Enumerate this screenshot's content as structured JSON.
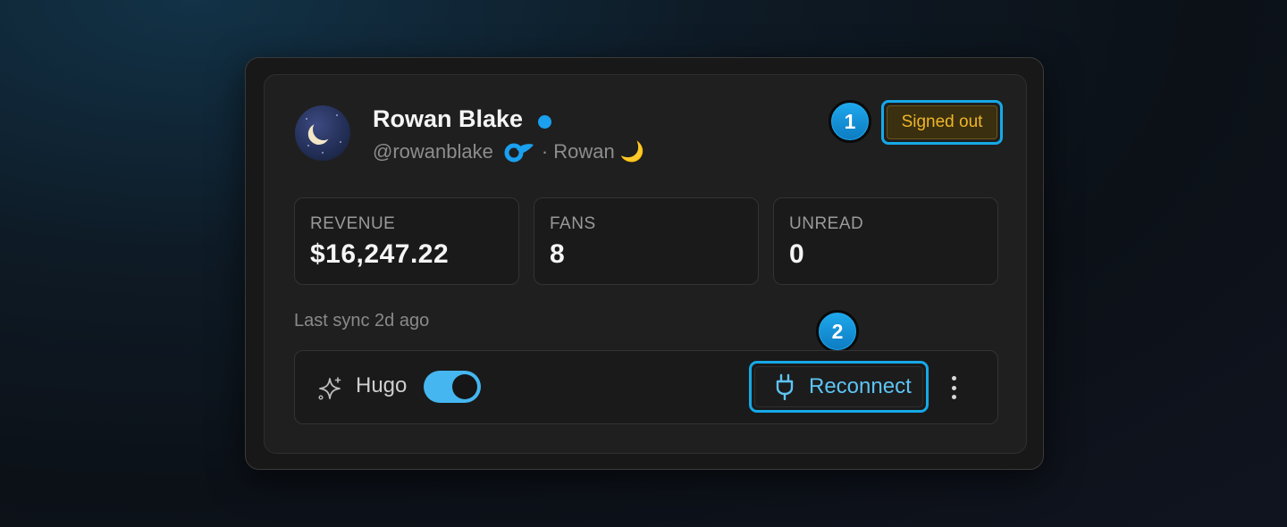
{
  "profile": {
    "name": "Rowan Blake",
    "handle": "@rowanblake",
    "display_suffix": "· Rowan 🌙",
    "online_color": "#1aa0ee"
  },
  "status_badge": {
    "label": "Signed out",
    "color": "#f0b528"
  },
  "steps": {
    "one": "1",
    "two": "2"
  },
  "stats": [
    {
      "label": "REVENUE",
      "value": "$16,247.22"
    },
    {
      "label": "FANS",
      "value": "8"
    },
    {
      "label": "UNREAD",
      "value": "0"
    }
  ],
  "last_sync": "Last sync 2d ago",
  "assistant": {
    "label": "Hugo",
    "enabled": true,
    "icon": "sparkle-icon"
  },
  "reconnect": {
    "label": "Reconnect",
    "icon": "plug-icon"
  },
  "accent": "#16a9e7"
}
